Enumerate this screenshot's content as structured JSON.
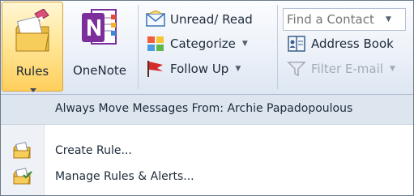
{
  "ribbon": {
    "rules": {
      "label": "Rules",
      "icon": "rules-wizard-icon"
    },
    "onenote": {
      "label": "OneNote",
      "icon": "onenote-icon"
    },
    "tags": [
      {
        "label": "Unread/ Read",
        "icon": "envelope-icon"
      },
      {
        "label": "Categorize",
        "icon": "categorize-icon",
        "dropdown": true
      },
      {
        "label": "Follow Up",
        "icon": "flag-icon",
        "dropdown": true
      }
    ],
    "find": {
      "placeholder": "Find a Contact",
      "address_book": "Address Book",
      "filter_email": "Filter E-mail",
      "filter_disabled": true
    }
  },
  "menu": {
    "header": "Always Move Messages From: Archie Papadopoulous",
    "items": [
      {
        "label": "Create Rule...",
        "icon": "create-rule-icon"
      },
      {
        "label": "Manage Rules & Alerts...",
        "icon": "manage-rules-icon"
      }
    ]
  },
  "colors": {
    "active_button": "#ffd76b",
    "ribbon_bg": "#e7eef7",
    "menu_header_bg": "#dde5ef",
    "flag_red": "#d22c2c",
    "onenote_purple": "#7b2e9c"
  }
}
